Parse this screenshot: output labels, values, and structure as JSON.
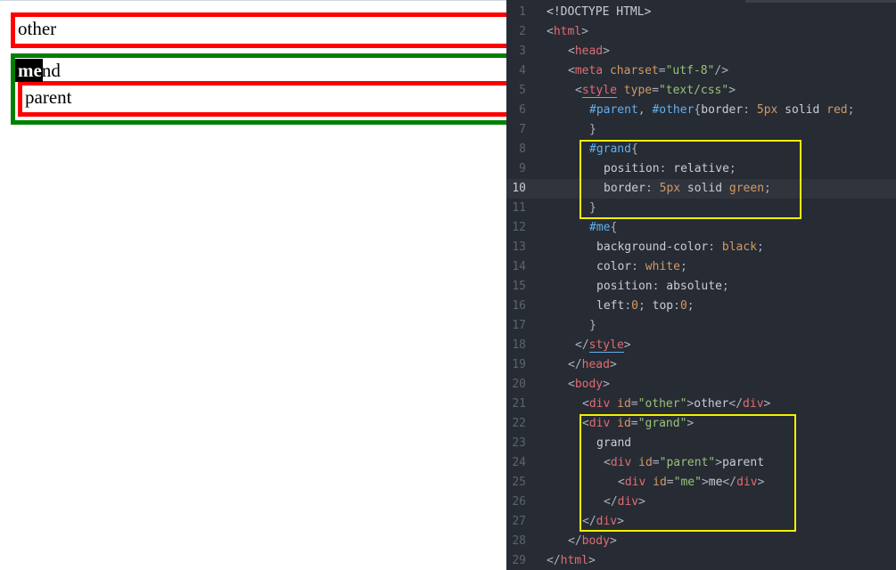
{
  "render": {
    "other_text": "other",
    "grand_text": "grand",
    "parent_text": "parent",
    "me_text": "me"
  },
  "editor": {
    "active_line": 10,
    "colors": {
      "background": "#272b33",
      "highlight_box": "#f2f200",
      "tag": "#e06c75",
      "attribute": "#d19a66",
      "string": "#98c379",
      "selector": "#61afef"
    },
    "lines": [
      {
        "n": "1",
        "indent": 0,
        "tokens": [
          {
            "t": "<!DOCTYPE HTML>",
            "c": "doc"
          }
        ]
      },
      {
        "n": "2",
        "indent": 0,
        "tokens": [
          {
            "t": "<",
            "c": "pun"
          },
          {
            "t": "html",
            "c": "tag"
          },
          {
            "t": ">",
            "c": "pun"
          }
        ]
      },
      {
        "n": "3",
        "indent": 3,
        "tokens": [
          {
            "t": "<",
            "c": "pun"
          },
          {
            "t": "head",
            "c": "tag"
          },
          {
            "t": ">",
            "c": "pun"
          }
        ]
      },
      {
        "n": "4",
        "indent": 3,
        "tokens": [
          {
            "t": "<",
            "c": "pun"
          },
          {
            "t": "meta",
            "c": "tag"
          },
          {
            "t": " charset",
            "c": "attr"
          },
          {
            "t": "=",
            "c": "pun"
          },
          {
            "t": "\"utf-8\"",
            "c": "str"
          },
          {
            "t": "/>",
            "c": "pun"
          }
        ]
      },
      {
        "n": "5",
        "indent": 4,
        "tokens": [
          {
            "t": "<",
            "c": "pun"
          },
          {
            "t": "style",
            "c": "styletag"
          },
          {
            "t": " type",
            "c": "attr"
          },
          {
            "t": "=",
            "c": "pun"
          },
          {
            "t": "\"text/css\"",
            "c": "str"
          },
          {
            "t": ">",
            "c": "pun"
          }
        ]
      },
      {
        "n": "6",
        "indent": 6,
        "tokens": [
          {
            "t": "#parent",
            "c": "sel"
          },
          {
            "t": ", ",
            "c": "pun"
          },
          {
            "t": "#other",
            "c": "sel"
          },
          {
            "t": "{",
            "c": "pun"
          },
          {
            "t": "border",
            "c": "prop"
          },
          {
            "t": ": ",
            "c": "pun"
          },
          {
            "t": "5px",
            "c": "num"
          },
          {
            "t": " solid ",
            "c": "prop"
          },
          {
            "t": "red",
            "c": "val"
          },
          {
            "t": ";",
            "c": "pun"
          }
        ]
      },
      {
        "n": "7",
        "indent": 6,
        "tokens": [
          {
            "t": "}",
            "c": "pun"
          }
        ]
      },
      {
        "n": "8",
        "indent": 6,
        "tokens": [
          {
            "t": "#grand",
            "c": "sel"
          },
          {
            "t": "{",
            "c": "pun"
          }
        ]
      },
      {
        "n": "9",
        "indent": 8,
        "tokens": [
          {
            "t": "position",
            "c": "prop"
          },
          {
            "t": ": ",
            "c": "pun"
          },
          {
            "t": "relative",
            "c": "prop"
          },
          {
            "t": ";",
            "c": "pun"
          }
        ]
      },
      {
        "n": "10",
        "indent": 8,
        "tokens": [
          {
            "t": "border",
            "c": "prop"
          },
          {
            "t": ": ",
            "c": "pun"
          },
          {
            "t": "5px",
            "c": "num"
          },
          {
            "t": " solid ",
            "c": "prop"
          },
          {
            "t": "green",
            "c": "val"
          },
          {
            "t": ";",
            "c": "pun"
          }
        ]
      },
      {
        "n": "11",
        "indent": 6,
        "tokens": [
          {
            "t": "}",
            "c": "pun"
          }
        ]
      },
      {
        "n": "12",
        "indent": 6,
        "tokens": [
          {
            "t": "#me",
            "c": "sel"
          },
          {
            "t": "{",
            "c": "pun"
          }
        ]
      },
      {
        "n": "13",
        "indent": 7,
        "tokens": [
          {
            "t": "background-color",
            "c": "prop"
          },
          {
            "t": ": ",
            "c": "pun"
          },
          {
            "t": "black",
            "c": "val"
          },
          {
            "t": ";",
            "c": "pun"
          }
        ]
      },
      {
        "n": "14",
        "indent": 7,
        "tokens": [
          {
            "t": "color",
            "c": "prop"
          },
          {
            "t": ": ",
            "c": "pun"
          },
          {
            "t": "white",
            "c": "val"
          },
          {
            "t": ";",
            "c": "pun"
          }
        ]
      },
      {
        "n": "15",
        "indent": 7,
        "tokens": [
          {
            "t": "position",
            "c": "prop"
          },
          {
            "t": ": ",
            "c": "pun"
          },
          {
            "t": "absolute",
            "c": "prop"
          },
          {
            "t": ";",
            "c": "pun"
          }
        ]
      },
      {
        "n": "16",
        "indent": 7,
        "tokens": [
          {
            "t": "left",
            "c": "prop"
          },
          {
            "t": ":",
            "c": "pun"
          },
          {
            "t": "0",
            "c": "num"
          },
          {
            "t": "; ",
            "c": "pun"
          },
          {
            "t": "top",
            "c": "prop"
          },
          {
            "t": ":",
            "c": "pun"
          },
          {
            "t": "0",
            "c": "num"
          },
          {
            "t": ";",
            "c": "pun"
          }
        ]
      },
      {
        "n": "17",
        "indent": 6,
        "tokens": [
          {
            "t": "}",
            "c": "pun"
          }
        ]
      },
      {
        "n": "18",
        "indent": 4,
        "tokens": [
          {
            "t": "</",
            "c": "pun"
          },
          {
            "t": "style",
            "c": "styletag"
          },
          {
            "t": ">",
            "c": "pun"
          }
        ]
      },
      {
        "n": "19",
        "indent": 3,
        "tokens": [
          {
            "t": "</",
            "c": "pun"
          },
          {
            "t": "head",
            "c": "tag"
          },
          {
            "t": ">",
            "c": "pun"
          }
        ]
      },
      {
        "n": "20",
        "indent": 3,
        "tokens": [
          {
            "t": "<",
            "c": "pun"
          },
          {
            "t": "body",
            "c": "tag"
          },
          {
            "t": ">",
            "c": "pun"
          }
        ]
      },
      {
        "n": "21",
        "indent": 5,
        "tokens": [
          {
            "t": "<",
            "c": "pun"
          },
          {
            "t": "div",
            "c": "tag"
          },
          {
            "t": " id",
            "c": "attr"
          },
          {
            "t": "=",
            "c": "pun"
          },
          {
            "t": "\"other\"",
            "c": "str"
          },
          {
            "t": ">",
            "c": "pun"
          },
          {
            "t": "other",
            "c": "txt"
          },
          {
            "t": "</",
            "c": "pun"
          },
          {
            "t": "div",
            "c": "tag"
          },
          {
            "t": ">",
            "c": "pun"
          }
        ]
      },
      {
        "n": "22",
        "indent": 5,
        "tokens": [
          {
            "t": "<",
            "c": "pun"
          },
          {
            "t": "div",
            "c": "tag"
          },
          {
            "t": " id",
            "c": "attr"
          },
          {
            "t": "=",
            "c": "pun"
          },
          {
            "t": "\"grand\"",
            "c": "str"
          },
          {
            "t": ">",
            "c": "pun"
          }
        ]
      },
      {
        "n": "23",
        "indent": 7,
        "tokens": [
          {
            "t": "grand",
            "c": "txt"
          }
        ]
      },
      {
        "n": "24",
        "indent": 8,
        "tokens": [
          {
            "t": "<",
            "c": "pun"
          },
          {
            "t": "div",
            "c": "tag"
          },
          {
            "t": " id",
            "c": "attr"
          },
          {
            "t": "=",
            "c": "pun"
          },
          {
            "t": "\"parent\"",
            "c": "str"
          },
          {
            "t": ">",
            "c": "pun"
          },
          {
            "t": "parent",
            "c": "txt"
          }
        ]
      },
      {
        "n": "25",
        "indent": 10,
        "tokens": [
          {
            "t": "<",
            "c": "pun"
          },
          {
            "t": "div",
            "c": "tag"
          },
          {
            "t": " id",
            "c": "attr"
          },
          {
            "t": "=",
            "c": "pun"
          },
          {
            "t": "\"me\"",
            "c": "str"
          },
          {
            "t": ">",
            "c": "pun"
          },
          {
            "t": "me",
            "c": "txt"
          },
          {
            "t": "</",
            "c": "pun"
          },
          {
            "t": "div",
            "c": "tag"
          },
          {
            "t": ">",
            "c": "pun"
          }
        ]
      },
      {
        "n": "26",
        "indent": 8,
        "tokens": [
          {
            "t": "</",
            "c": "pun"
          },
          {
            "t": "div",
            "c": "tag"
          },
          {
            "t": ">",
            "c": "pun"
          }
        ]
      },
      {
        "n": "27",
        "indent": 5,
        "tokens": [
          {
            "t": "</",
            "c": "pun"
          },
          {
            "t": "div",
            "c": "tag"
          },
          {
            "t": ">",
            "c": "pun"
          }
        ]
      },
      {
        "n": "28",
        "indent": 3,
        "tokens": [
          {
            "t": "</",
            "c": "pun"
          },
          {
            "t": "body",
            "c": "tag"
          },
          {
            "t": ">",
            "c": "pun"
          }
        ]
      },
      {
        "n": "29",
        "indent": 0,
        "tokens": [
          {
            "t": "</",
            "c": "pun"
          },
          {
            "t": "html",
            "c": "tag"
          },
          {
            "t": ">",
            "c": "pun"
          }
        ]
      }
    ]
  }
}
